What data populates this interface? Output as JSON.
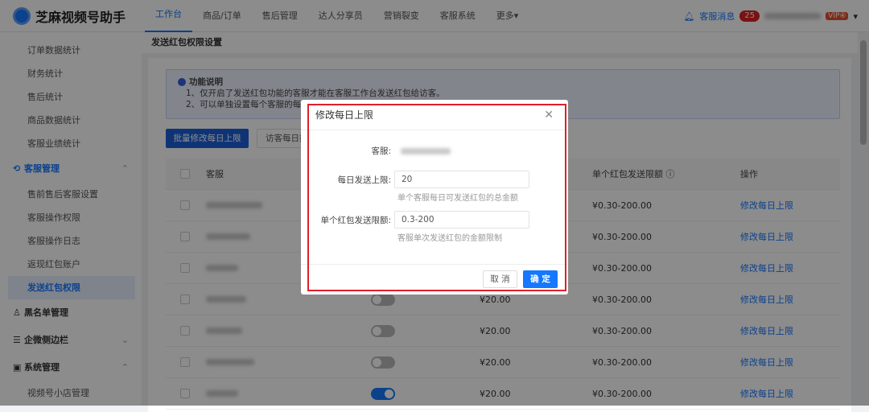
{
  "app": {
    "name": "芝麻视频号助手"
  },
  "nav": [
    "工作台",
    "商品/订单",
    "售后管理",
    "达人分享员",
    "营销裂变",
    "客服系统",
    "更多▾"
  ],
  "header": {
    "messages_label": "客服消息",
    "messages_count": "25",
    "vip": "VIP④"
  },
  "sidebar": {
    "items": [
      "订单数据统计",
      "财务统计",
      "售后统计",
      "商品数据统计",
      "客服业绩统计"
    ],
    "group_service": "客服管理",
    "service_items": [
      "售前售后客服设置",
      "客服操作权限",
      "客服操作日志",
      "返现红包账户",
      "发送红包权限"
    ],
    "group_blacklist": "黑名单管理",
    "group_wecom": "企微侧边栏",
    "group_system": "系统管理",
    "system_items": [
      "视频号小店管理"
    ]
  },
  "page": {
    "title": "发送红包权限设置",
    "notice_title": "功能说明",
    "notice_lines": [
      "1、仅开启了发送红包功能的客服才能在客服工作台发送红包给访客。",
      "2、可以单独设置每个客服的每日发送上限和单个红包发送限额。"
    ],
    "batch_button": "批量修改每日上限",
    "visitor_button": "访客每日接收上限"
  },
  "table": {
    "headers": [
      "客服",
      "",
      "",
      "单个红包发送限额",
      "操作"
    ],
    "rows": [
      {
        "enabled": false,
        "daily": "",
        "range": "¥0.30-200.00",
        "action": "修改每日上限"
      },
      {
        "enabled": false,
        "daily": "",
        "range": "¥0.30-200.00",
        "action": "修改每日上限"
      },
      {
        "enabled": false,
        "daily": "",
        "range": "¥0.30-200.00",
        "action": "修改每日上限"
      },
      {
        "enabled": false,
        "daily": "¥20.00",
        "range": "¥0.30-200.00",
        "action": "修改每日上限"
      },
      {
        "enabled": false,
        "daily": "¥20.00",
        "range": "¥0.30-200.00",
        "action": "修改每日上限"
      },
      {
        "enabled": false,
        "daily": "¥20.00",
        "range": "¥0.30-200.00",
        "action": "修改每日上限"
      },
      {
        "enabled": true,
        "daily": "¥20.00",
        "range": "¥0.30-200.00",
        "action": "修改每日上限"
      }
    ]
  },
  "modal": {
    "title": "修改每日上限",
    "service_label": "客服:",
    "daily_label": "每日发送上限:",
    "daily_value": "20",
    "daily_hint": "单个客服每日可发送红包的总金额",
    "single_label": "单个红包发送限额:",
    "single_value": "0.3-200",
    "single_hint": "客服单次发送红包的金额限制",
    "cancel": "取 消",
    "ok": "确 定"
  }
}
